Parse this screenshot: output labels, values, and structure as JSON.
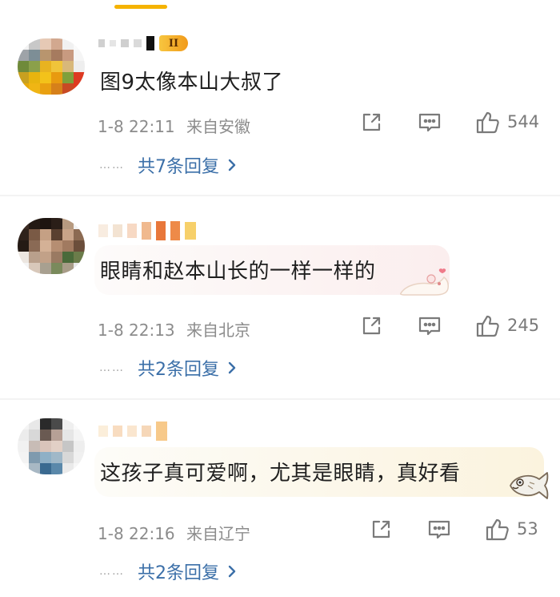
{
  "comments": [
    {
      "badge": "II",
      "text": "图9太像本山大叔了",
      "time": "1-8 22:11",
      "location": "来自安徽",
      "likes": "544",
      "replies": "共7条回复"
    },
    {
      "text": "眼睛和赵本山长的一样一样的",
      "time": "1-8 22:13",
      "location": "来自北京",
      "likes": "245",
      "replies": "共2条回复"
    },
    {
      "text": "这孩子真可爱啊，尤其是眼睛，真好看",
      "time": "1-8 22:16",
      "location": "来自辽宁",
      "likes": "53",
      "replies": "共2条回复"
    }
  ],
  "reply_dots": "……",
  "colors": {
    "link": "#3b6fa8",
    "meta": "#8c8c8c",
    "indicator": "#f5b301"
  },
  "icons": [
    "share-icon",
    "comment-icon",
    "like-icon",
    "chevron-right-icon"
  ]
}
